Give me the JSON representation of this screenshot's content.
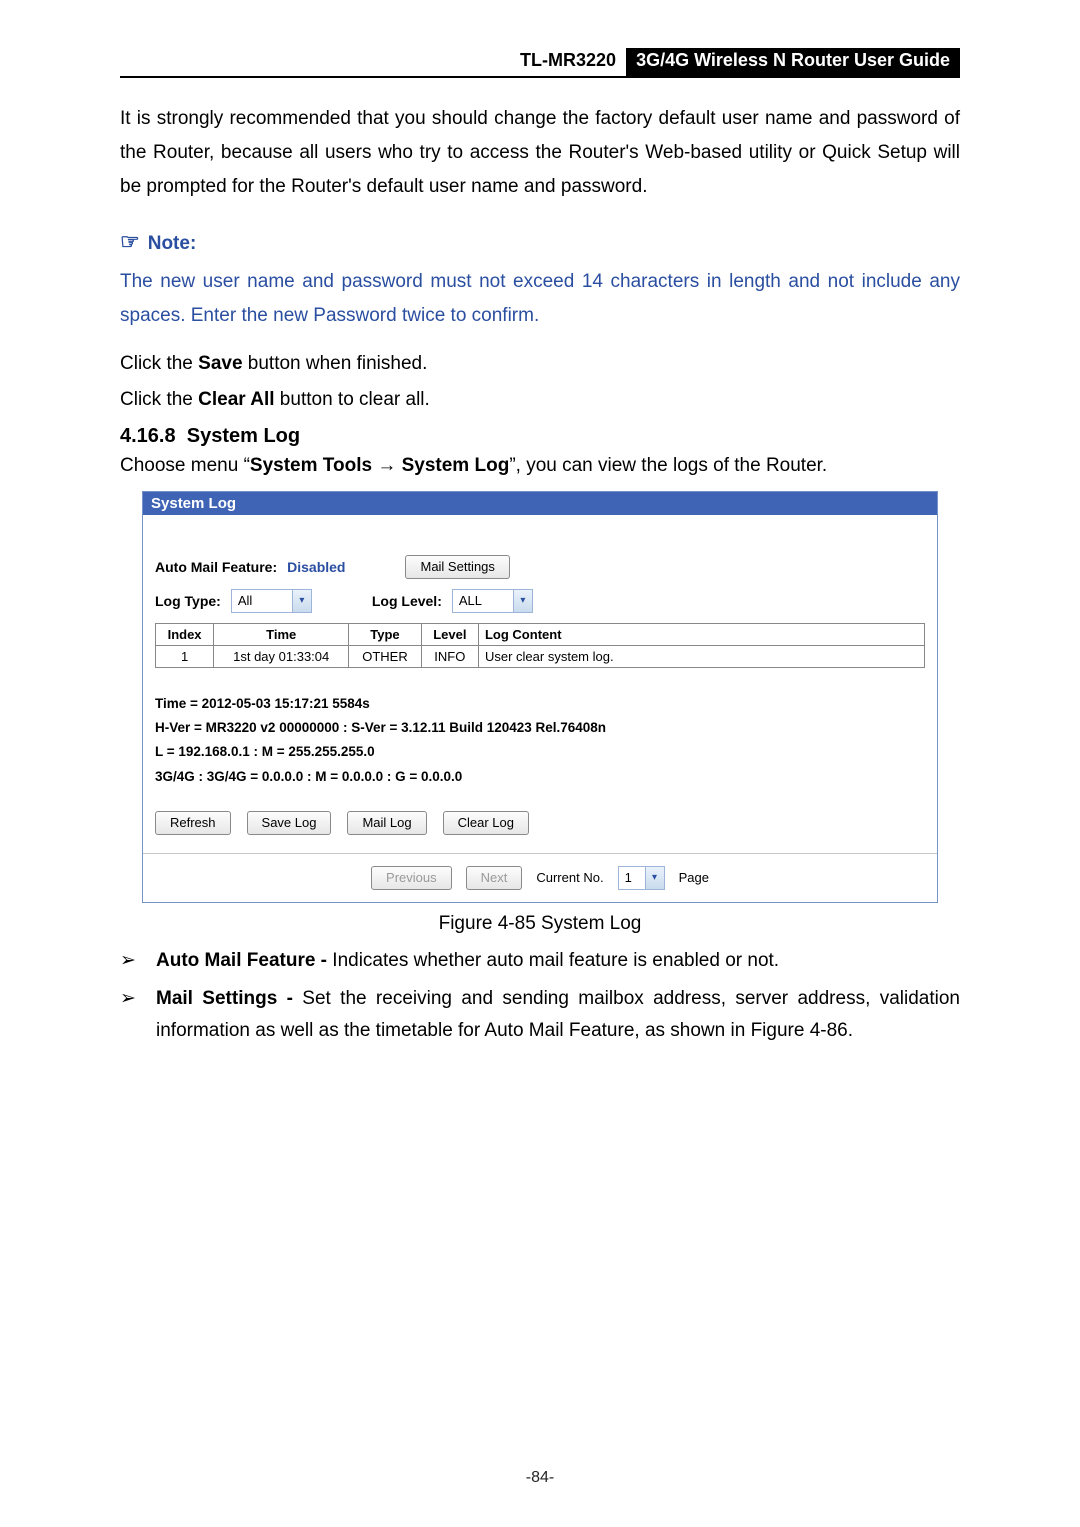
{
  "header": {
    "model": "TL-MR3220",
    "title": "3G/4G Wireless N Router User Guide"
  },
  "intro_before_bold": "It is strongly recommended that you should change the factory default user name and password of the Router, because all users who try to access the Router's Web-based utility or Quick Setup will be prompted for the Router's default user name and password.",
  "note": {
    "label": "Note:",
    "body": "The new user name and password must not exceed 14 characters in length and not include any spaces. Enter the new Password twice to confirm."
  },
  "save_line_prefix": "Click the ",
  "save_word": "Save",
  "save_line_suffix": " button when finished.",
  "clear_line_prefix": "Click the ",
  "clear_word": "Clear All",
  "clear_line_suffix": " button to clear all.",
  "section": {
    "num": "4.16.8",
    "title": "System Log",
    "desc_prefix": "Choose menu “",
    "desc_bold1": "System Tools",
    "desc_arrow": " → ",
    "desc_bold2": "System Log",
    "desc_suffix": "”, you can view the logs of the Router."
  },
  "panel": {
    "title": "System Log",
    "auto_mail_label": "Auto Mail Feature:",
    "auto_mail_value": "Disabled",
    "mail_settings_btn": "Mail Settings",
    "log_type_label": "Log Type:",
    "log_type_value": "All",
    "log_level_label": "Log Level:",
    "log_level_value": "ALL",
    "table": {
      "headers": {
        "index": "Index",
        "time": "Time",
        "type": "Type",
        "level": "Level",
        "content": "Log Content"
      },
      "rows": [
        {
          "index": "1",
          "time": "1st day 01:33:04",
          "type": "OTHER",
          "level": "INFO",
          "content": "User clear system log."
        }
      ]
    },
    "sysinfo": [
      "Time = 2012-05-03 15:17:21 5584s",
      "H-Ver = MR3220 v2 00000000 : S-Ver = 3.12.11 Build 120423 Rel.76408n",
      "L = 192.168.0.1 : M = 255.255.255.0",
      "3G/4G : 3G/4G = 0.0.0.0 : M = 0.0.0.0 : G = 0.0.0.0"
    ],
    "buttons": {
      "refresh": "Refresh",
      "save_log": "Save Log",
      "mail_log": "Mail Log",
      "clear_log": "Clear Log"
    },
    "pager": {
      "prev": "Previous",
      "next": "Next",
      "current_label": "Current No.",
      "current_val": "1",
      "page_label": "Page"
    }
  },
  "figure_caption": "Figure 4-85   System Log",
  "bullets": [
    {
      "bold": "Auto Mail Feature - ",
      "text": "Indicates whether auto mail feature is enabled or not."
    },
    {
      "bold": "Mail Settings - ",
      "text": "Set the receiving and sending mailbox address, server address, validation information as well as the timetable for Auto Mail Feature, as shown in Figure 4-86."
    }
  ],
  "page_number": "-84-"
}
